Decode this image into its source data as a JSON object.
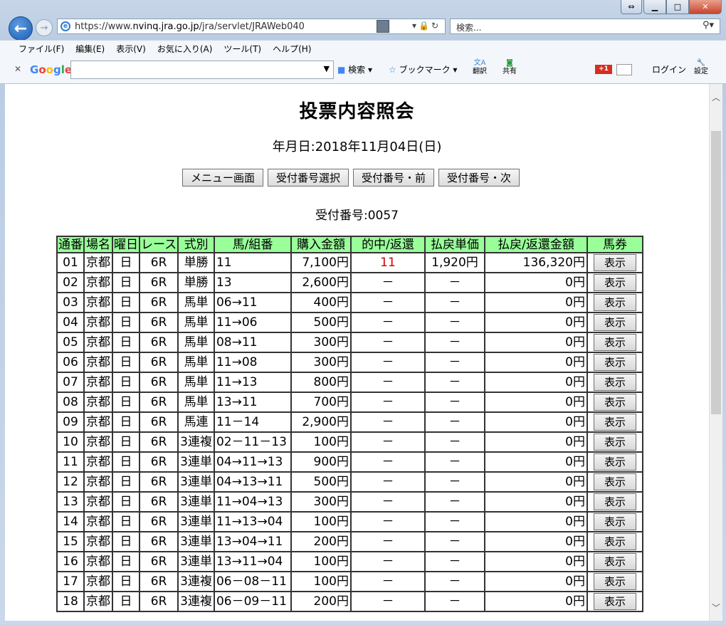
{
  "browser": {
    "url_prefix": "https://www.",
    "url_host": "nvinq.jra.go.jp",
    "url_path": "/jra/servlet/JRAWeb040",
    "search_placeholder": "検索...",
    "menu": [
      "ファイル(F)",
      "編集(E)",
      "表示(V)",
      "お気に入り(A)",
      "ツール(T)",
      "ヘルプ(H)"
    ],
    "google": {
      "search_label": "検索",
      "bookmark_label": "ブックマーク",
      "translate_label": "翻訳",
      "share_label": "共有",
      "gplus_label": "+1",
      "login_label": "ログイン",
      "settings_label": "設定"
    }
  },
  "page": {
    "title": "投票内容照会",
    "date": "年月日:2018年11月04日(日)",
    "buttons": [
      "メニュー画面",
      "受付番号選択",
      "受付番号・前",
      "受付番号・次"
    ],
    "receipt_no": "受付番号:0057",
    "headers": [
      "通番",
      "場名",
      "曜日",
      "レース",
      "式別",
      "馬/組番",
      "購入金額",
      "的中/返還",
      "払戻単価",
      "払戻/返還金額",
      "馬券"
    ],
    "view_label": "表示",
    "rows": [
      [
        "01",
        "京都",
        "日",
        "6R",
        "単勝",
        "11",
        "7,100円",
        "11",
        "1,920円",
        "136,320円"
      ],
      [
        "02",
        "京都",
        "日",
        "6R",
        "単勝",
        "13",
        "2,600円",
        "－",
        "－",
        "0円"
      ],
      [
        "03",
        "京都",
        "日",
        "6R",
        "馬単",
        "06→11",
        "400円",
        "－",
        "－",
        "0円"
      ],
      [
        "04",
        "京都",
        "日",
        "6R",
        "馬単",
        "11→06",
        "500円",
        "－",
        "－",
        "0円"
      ],
      [
        "05",
        "京都",
        "日",
        "6R",
        "馬単",
        "08→11",
        "300円",
        "－",
        "－",
        "0円"
      ],
      [
        "06",
        "京都",
        "日",
        "6R",
        "馬単",
        "11→08",
        "300円",
        "－",
        "－",
        "0円"
      ],
      [
        "07",
        "京都",
        "日",
        "6R",
        "馬単",
        "11→13",
        "800円",
        "－",
        "－",
        "0円"
      ],
      [
        "08",
        "京都",
        "日",
        "6R",
        "馬単",
        "13→11",
        "700円",
        "－",
        "－",
        "0円"
      ],
      [
        "09",
        "京都",
        "日",
        "6R",
        "馬連",
        "11－14",
        "2,900円",
        "－",
        "－",
        "0円"
      ],
      [
        "10",
        "京都",
        "日",
        "6R",
        "3連複",
        "02－11－13",
        "100円",
        "－",
        "－",
        "0円"
      ],
      [
        "11",
        "京都",
        "日",
        "6R",
        "3連単",
        "04→11→13",
        "900円",
        "－",
        "－",
        "0円"
      ],
      [
        "12",
        "京都",
        "日",
        "6R",
        "3連単",
        "04→13→11",
        "500円",
        "－",
        "－",
        "0円"
      ],
      [
        "13",
        "京都",
        "日",
        "6R",
        "3連単",
        "11→04→13",
        "300円",
        "－",
        "－",
        "0円"
      ],
      [
        "14",
        "京都",
        "日",
        "6R",
        "3連単",
        "11→13→04",
        "100円",
        "－",
        "－",
        "0円"
      ],
      [
        "15",
        "京都",
        "日",
        "6R",
        "3連単",
        "13→04→11",
        "200円",
        "－",
        "－",
        "0円"
      ],
      [
        "16",
        "京都",
        "日",
        "6R",
        "3連単",
        "13→11→04",
        "100円",
        "－",
        "－",
        "0円"
      ],
      [
        "17",
        "京都",
        "日",
        "6R",
        "3連複",
        "06－08－11",
        "100円",
        "－",
        "－",
        "0円"
      ],
      [
        "18",
        "京都",
        "日",
        "6R",
        "3連複",
        "06－09－11",
        "200円",
        "－",
        "－",
        "0円"
      ]
    ],
    "hit_color": "#cc0000",
    "header_color": "#99ff99"
  }
}
